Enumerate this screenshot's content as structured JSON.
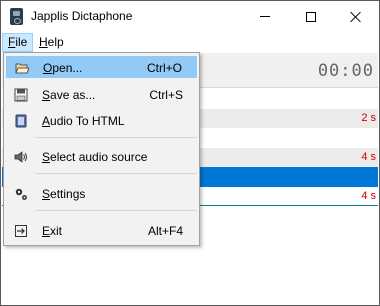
{
  "window": {
    "title": "Japplis Dictaphone"
  },
  "menubar": {
    "file_prefix": "F",
    "file_rest": "ile",
    "help_prefix": "H",
    "help_rest": "elp"
  },
  "timer": "00:00",
  "recordings": [
    {
      "duration": "2 s"
    },
    {
      "duration": "4 s"
    },
    {
      "duration": ""
    },
    {
      "duration": "4 s"
    }
  ],
  "file_menu": {
    "items": [
      {
        "prefix": "O",
        "rest": "pen...",
        "shortcut": "Ctrl+O",
        "icon": "folder-open-icon"
      },
      {
        "prefix": "S",
        "rest": "ave as...",
        "shortcut": "Ctrl+S",
        "icon": "save-disk-icon"
      },
      {
        "prefix": "A",
        "rest": "udio To HTML",
        "shortcut": "",
        "icon": "html-book-icon"
      },
      {
        "prefix": "S",
        "rest": "elect audio source",
        "shortcut": "",
        "icon": "speaker-icon"
      },
      {
        "prefix": "S",
        "rest": "ettings",
        "shortcut": "",
        "icon": "gears-icon"
      },
      {
        "prefix": "E",
        "rest": "xit",
        "shortcut": "Alt+F4",
        "icon": "exit-icon"
      }
    ]
  },
  "colors": {
    "highlight": "#91c9f7",
    "selection": "#0078d7",
    "duration_text": "#d00000"
  }
}
